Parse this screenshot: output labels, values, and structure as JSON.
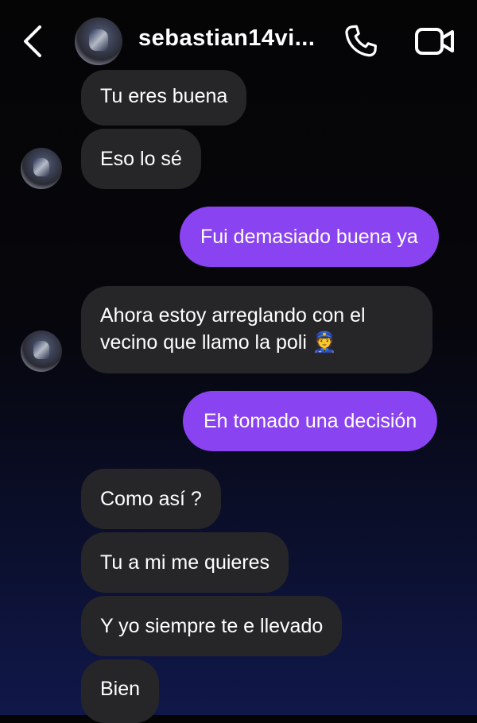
{
  "header": {
    "back_icon": "chevron-left-icon",
    "username": "sebastian14vi...",
    "call_icon": "phone-icon",
    "video_icon": "video-camera-icon"
  },
  "messages": [
    {
      "side": "incoming",
      "text": "Tu eres buena"
    },
    {
      "side": "incoming",
      "text": "Eso lo sé",
      "avatar": true
    },
    {
      "side": "outgoing",
      "text": "Fui demasiado buena ya"
    },
    {
      "side": "incoming",
      "lines": [
        "Ahora estoy arreglando con el",
        "vecino que llamo la poli 👮"
      ],
      "avatar": true
    },
    {
      "side": "outgoing",
      "text": "Eh tomado una decisión"
    },
    {
      "side": "incoming",
      "text": "Como así ?"
    },
    {
      "side": "incoming",
      "text": "Tu a mi me quieres"
    },
    {
      "side": "incoming",
      "text": "Y yo siempre te e llevado"
    },
    {
      "side": "incoming",
      "text": "Bien"
    }
  ],
  "colors": {
    "outgoing_bubble": "#8a43f0",
    "incoming_bubble": "#262629",
    "background_top": "#050506",
    "background_bottom": "#10184a"
  }
}
